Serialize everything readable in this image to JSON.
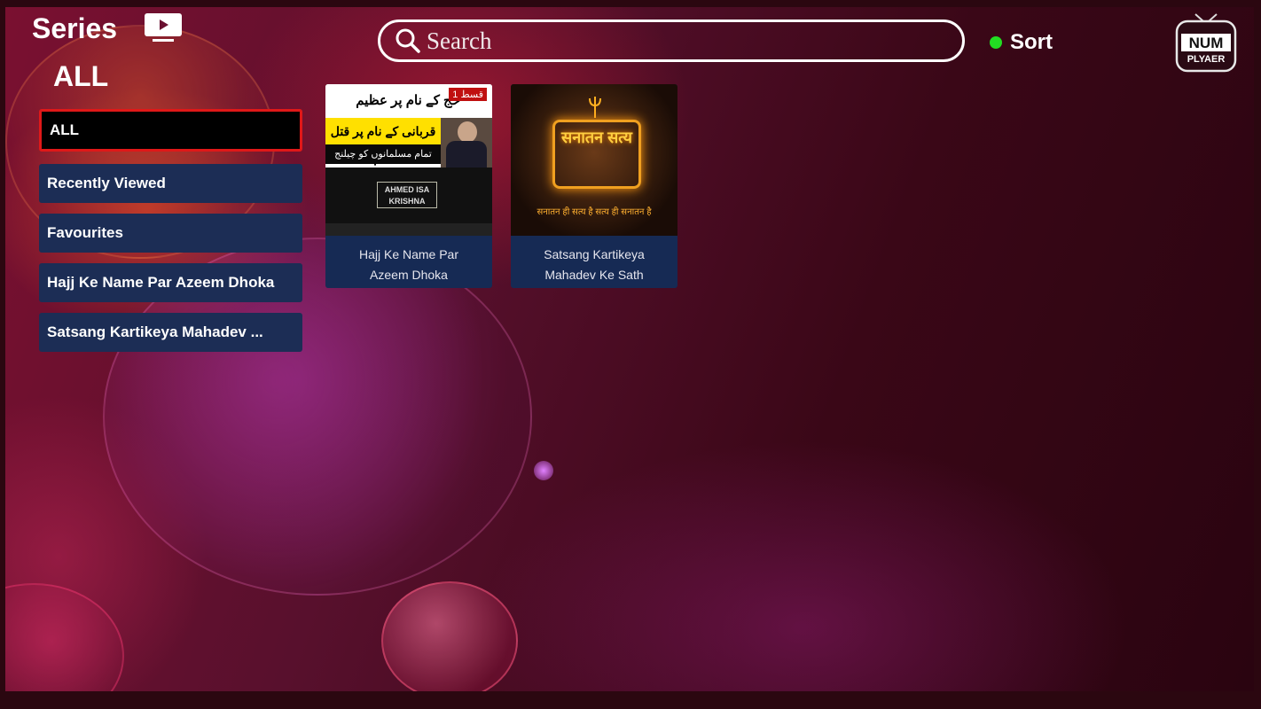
{
  "header": {
    "title": "Series",
    "category_title": "ALL"
  },
  "search": {
    "placeholder": "Search"
  },
  "sort": {
    "label": "Sort",
    "indicator_color": "#22dd22"
  },
  "logo": {
    "line1": "NUM",
    "line2": "PLYAER"
  },
  "sidebar": {
    "items": [
      {
        "label": "ALL",
        "active": true
      },
      {
        "label": "Recently Viewed"
      },
      {
        "label": "Favourites"
      },
      {
        "label": "Hajj Ke Name Par Azeem Dhoka"
      },
      {
        "label": "Satsang Kartikeya Mahadev ..."
      }
    ]
  },
  "cards": [
    {
      "title_line1": "Hajj Ke Name Par",
      "title_line2": "Azeem Dhoka",
      "thumb": {
        "urdu_top": "حج کے نام پر عظیم دھوکہ",
        "badge": "قسط 1",
        "urdu_yellow": "قربانی کے نام پر قتل عام",
        "urdu_strip": "تمام مسلمانوں کو چیلنج",
        "box": "AHMED ISA KRISHNA"
      }
    },
    {
      "title_line1": "Satsang Kartikeya",
      "title_line2": "Mahadev Ke Sath",
      "thumb": {
        "hindi_title": "सनातन सत्य",
        "hindi_sub": "सनातन ही सत्य है सत्य ही सनातन है"
      }
    }
  ],
  "colors": {
    "accent_active_border": "#e01818",
    "category_bg": "#1c2d55",
    "card_bg": "#162a54"
  }
}
